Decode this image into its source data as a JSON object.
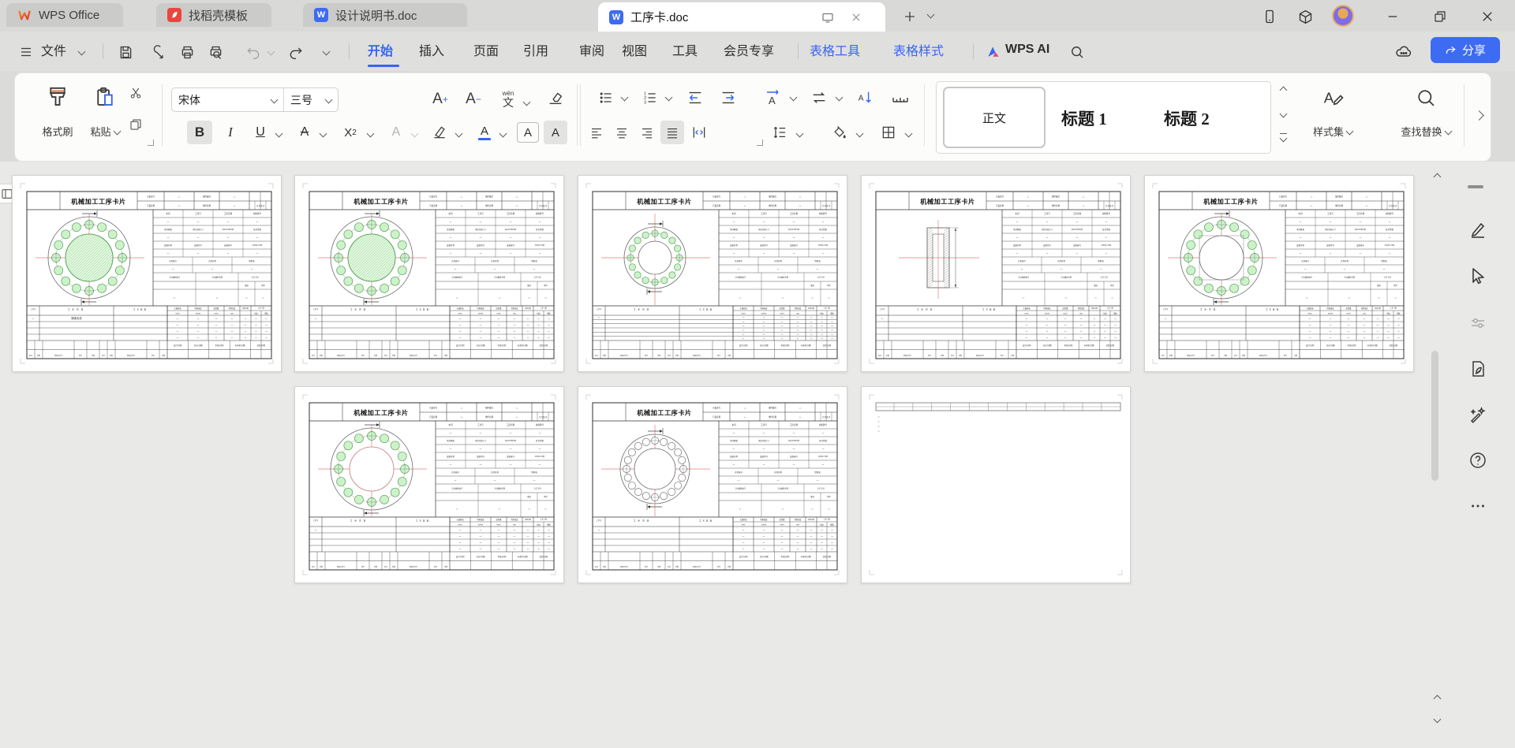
{
  "colors": {
    "accent_blue": "#3566EF",
    "share_button_blue": "#3D6BF2",
    "wps_red": "#E2392C",
    "doc_icon_blue": "#3D6BF2",
    "drawing_green_fill": "#CDF2CA",
    "drawing_green_stroke": "#5BA55B",
    "drawing_red_line": "#E07F7F"
  },
  "titlebar": {
    "tabs": [
      {
        "label": "WPS Office"
      },
      {
        "label": "找稻壳模板"
      },
      {
        "label": "设计说明书.doc"
      },
      {
        "label": "工序卡.doc"
      }
    ]
  },
  "menubar": {
    "file": "文件",
    "items": [
      {
        "label": "开始",
        "active": true
      },
      {
        "label": "插入"
      },
      {
        "label": "页面"
      },
      {
        "label": "引用"
      },
      {
        "label": "审阅"
      },
      {
        "label": "视图"
      },
      {
        "label": "工具"
      },
      {
        "label": "会员专享"
      }
    ],
    "contextual": [
      {
        "label": "表格工具"
      },
      {
        "label": "表格样式"
      }
    ],
    "wps_ai": "WPS AI",
    "share": "分享"
  },
  "ribbon": {
    "format_painter": "格式刷",
    "paste": "粘贴",
    "font_name": "宋体",
    "font_size": "三号",
    "styles": [
      {
        "name": "正文",
        "selected": true
      },
      {
        "name": "标题 1"
      },
      {
        "name": "标题 2"
      }
    ],
    "style_set": "样式集",
    "find_replace": "查找替换"
  },
  "card": {
    "title": "机械加工工序卡片",
    "header_labels": [
      "产品型号",
      "零件图号",
      "产品名称",
      "零件名称",
      "共 页 第 页"
    ],
    "info_rows": [
      [
        "车间",
        "工序号",
        "工序名称",
        "材料牌号"
      ],
      [
        "毛坯种类",
        "毛坯外形尺寸",
        "每毛坯可制件数",
        "每台件数"
      ],
      [
        "设备名称",
        "设备型号",
        "设备编号",
        "同时加工件数"
      ],
      [
        "夹具编号",
        "夹具名称",
        "切削液"
      ],
      [
        "工位器具编号",
        "工位器具名称",
        "工序工时"
      ],
      [
        "准终",
        "单件"
      ]
    ],
    "table_headers": [
      "工步号",
      "工步内容",
      "工艺装备",
      "主轴转速",
      "切削速度",
      "进给量",
      "切削深度",
      "进给次数",
      "工步工时"
    ],
    "table_units": [
      "r/min",
      "m/min",
      "mm/r",
      "mm",
      "机动",
      "辅助"
    ],
    "footer_labels": [
      "设计(日期)",
      "校对(日期)",
      "审核(日期)",
      "标准化(日期)",
      "会签(日期)"
    ],
    "revision_labels": [
      "标记",
      "处数",
      "更改文件号",
      "签字",
      "日期"
    ]
  },
  "pages": [
    {
      "name": "page-1",
      "drawing": "flange-green",
      "rows": 4,
      "step_note": "铸造毛坯"
    },
    {
      "name": "page-2",
      "drawing": "flange-green",
      "rows": 4,
      "step_note": ""
    },
    {
      "name": "page-3",
      "drawing": "flange-small",
      "rows": 6,
      "step_note": ""
    },
    {
      "name": "page-4",
      "drawing": "section",
      "rows": 4,
      "step_note": ""
    },
    {
      "name": "page-5",
      "drawing": "flange-open",
      "rows": 4,
      "step_note": ""
    },
    {
      "name": "page-6",
      "drawing": "flange-red",
      "rows": 4,
      "step_note": ""
    },
    {
      "name": "page-7",
      "drawing": "flange-ring",
      "rows": 4,
      "step_note": ""
    },
    {
      "name": "page-8",
      "drawing": "blank",
      "rows": 0,
      "step_note": ""
    }
  ]
}
